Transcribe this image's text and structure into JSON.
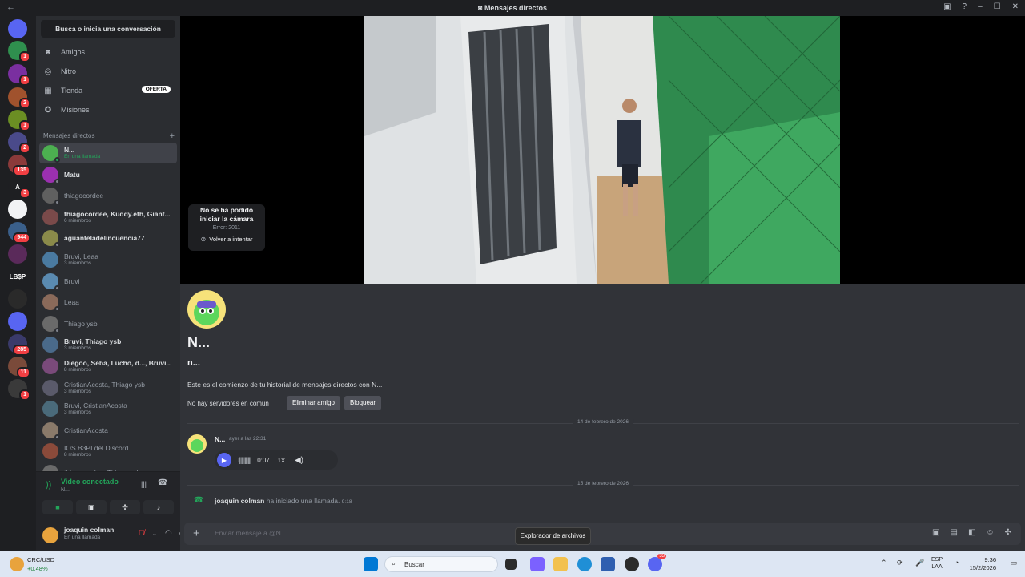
{
  "titlebar": {
    "title": "Mensajes directos"
  },
  "servers": [
    {
      "label": "",
      "color": "#5865f2",
      "icon": "discord-logo-icon"
    },
    {
      "label": "",
      "color": "#2f8f4e",
      "badge": "1"
    },
    {
      "label": "",
      "color": "#7a2fa0",
      "badge": "1"
    },
    {
      "label": "",
      "color": "#a0522d",
      "badge": "2"
    },
    {
      "label": "",
      "color": "#6b8e23",
      "badge": "1"
    },
    {
      "label": "",
      "color": "#4a4a8a",
      "badge": "2"
    },
    {
      "label": "",
      "color": "#8b3a3a",
      "badge": "135"
    },
    {
      "label": "A",
      "color": "#1e1f22",
      "badge": "3"
    },
    {
      "label": "",
      "color": "#f2f3f5"
    },
    {
      "label": "",
      "color": "#3a5f8a",
      "badge": "944"
    },
    {
      "label": "",
      "color": "#5a2a5a"
    },
    {
      "label": "LB$P",
      "color": "#1e1f22"
    },
    {
      "label": "",
      "color": "#2a2a2a"
    },
    {
      "label": "",
      "color": "#5865f2"
    },
    {
      "label": "",
      "color": "#3a3a6a",
      "badge": "285"
    },
    {
      "label": "",
      "color": "#7a4a3a",
      "badge": "11"
    },
    {
      "label": "",
      "color": "#3a3a3a",
      "badge": "1"
    }
  ],
  "search": {
    "placeholder": "Busca o inicia una conversación"
  },
  "nav": [
    {
      "label": "Amigos",
      "icon": "friends-icon",
      "glyph": "☻"
    },
    {
      "label": "Nitro",
      "icon": "nitro-icon",
      "glyph": "◎"
    },
    {
      "label": "Tienda",
      "icon": "shop-icon",
      "glyph": "▦",
      "badge": "OFERTA"
    },
    {
      "label": "Misiones",
      "icon": "quests-icon",
      "glyph": "✪"
    }
  ],
  "dm_header": "Mensajes directos",
  "dms": [
    {
      "name": "N...",
      "sub": "En una llamada",
      "bold": true,
      "sel": true,
      "color": "#4caf50",
      "subcolor": "green"
    },
    {
      "name": "Matu",
      "sub": "",
      "bold": true,
      "color": "#9b30b0"
    },
    {
      "name": "thiagocordee",
      "sub": "",
      "bold": false,
      "color": "#606060"
    },
    {
      "name": "thiagocordee, Kuddy.eth, Gianf...",
      "sub": "6 miembros",
      "bold": true,
      "color": "#7a4a4a"
    },
    {
      "name": "aguanteladelincuencia77",
      "sub": "",
      "bold": true,
      "color": "#8a8a4a"
    },
    {
      "name": "Bruvi, Leaa",
      "sub": "3 miembros",
      "bold": false,
      "color": "#4a7aa0"
    },
    {
      "name": "Bruvi",
      "sub": "",
      "bold": false,
      "color": "#5a8ab0"
    },
    {
      "name": "Leaa",
      "sub": "",
      "bold": false,
      "color": "#8a6a5a"
    },
    {
      "name": "Thiago ysb",
      "sub": "",
      "bold": false,
      "color": "#6a6a6a"
    },
    {
      "name": "Bruvi, Thiago ysb",
      "sub": "3 miembros",
      "bold": true,
      "color": "#4a6a8a"
    },
    {
      "name": "Diegoo, Seba, Lucho, d..., Bruvi...",
      "sub": "8 miembros",
      "bold": true,
      "color": "#7a4a7a"
    },
    {
      "name": "CristianAcosta, Thiago ysb",
      "sub": "3 miembros",
      "bold": false,
      "color": "#5a5a6a"
    },
    {
      "name": "Bruvi, CristianAcosta",
      "sub": "3 miembros",
      "bold": false,
      "color": "#4a6a7a"
    },
    {
      "name": "CristianAcosta",
      "sub": "",
      "bold": false,
      "color": "#8a7a6a"
    },
    {
      "name": "IOS B3PI del Discord",
      "sub": "8 miembros",
      "bold": false,
      "color": "#8a4a3a"
    },
    {
      "name": "thiagocordee, Thiago ysb",
      "sub": "",
      "bold": false,
      "color": "#6a6a6a"
    }
  ],
  "voice": {
    "title": "Video conectado",
    "sub": "N..."
  },
  "user": {
    "name": "joaquin colman",
    "status": "En una llamada"
  },
  "camera_error": {
    "title": "No se ha podido iniciar la cámara",
    "code": "Error: 2011",
    "retry": "Volver a intentar"
  },
  "profile": {
    "display_name": "N...",
    "username": "n...",
    "intro": "Este es el comienzo de tu historial de mensajes directos con N...",
    "no_common": "No hay servidores en común",
    "remove_friend": "Eliminar amigo",
    "block": "Bloquear"
  },
  "messages": {
    "date1": "14 de febrero de 2026",
    "msg1_author": "N...",
    "msg1_time": "ayer a las 22:31",
    "voice_duration": "0:07",
    "voice_speed": "1X",
    "date2": "15 de febrero de 2026",
    "call_author": "joaquin colman",
    "call_text": "ha iniciado una llamada.",
    "call_time": "9:18"
  },
  "composer": {
    "placeholder": "Enviar mensaje a @N..."
  },
  "tooltip": "Explorador de archivos",
  "taskbar": {
    "weather_title": "CRC/USD",
    "weather_value": "+0,48%",
    "search": "Buscar",
    "lang1": "ESP",
    "lang2": "LAA",
    "time": "9:36",
    "date": "15/2/2026",
    "discord_badge": "33"
  }
}
